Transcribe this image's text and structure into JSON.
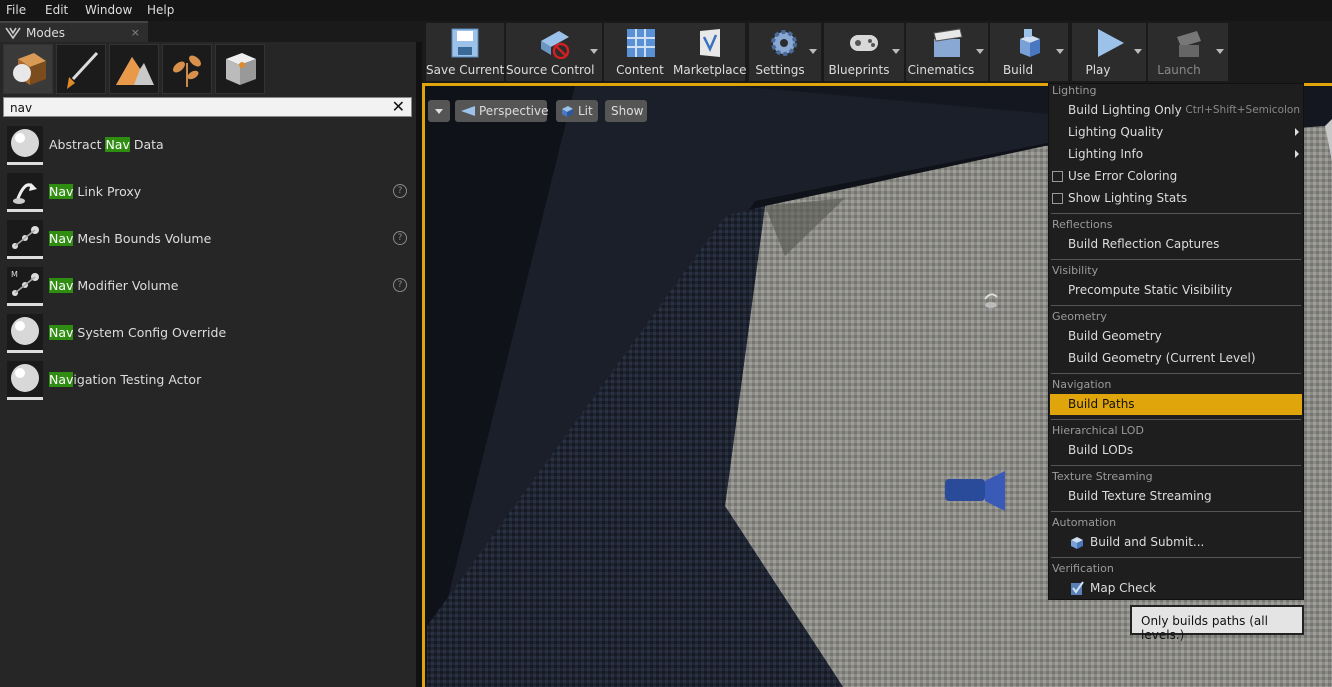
{
  "menubar": {
    "items": [
      "File",
      "Edit",
      "Window",
      "Help"
    ]
  },
  "modes": {
    "tab_title": "Modes",
    "close_glyph": "×",
    "search": {
      "value": "nav",
      "clear_glyph": "✕"
    },
    "results": [
      {
        "pre": "Abstract ",
        "hl": "Nav",
        "post": " Data",
        "help": false
      },
      {
        "pre": "",
        "hl": "Nav",
        "post": " Link Proxy",
        "help": true
      },
      {
        "pre": "",
        "hl": "Nav",
        "post": " Mesh Bounds Volume",
        "help": true
      },
      {
        "pre": "",
        "hl": "Nav",
        "post": " Modifier Volume",
        "help": true
      },
      {
        "pre": "",
        "hl": "Nav",
        "post": " System Config Override",
        "help": false
      },
      {
        "pre": "",
        "hl": "Nav",
        "post": "igation Testing Actor",
        "help": false
      }
    ],
    "help_glyph": "?"
  },
  "toolbar": {
    "save_current": "Save Current",
    "source_control": "Source Control",
    "content": "Content",
    "marketplace": "Marketplace",
    "settings": "Settings",
    "blueprints": "Blueprints",
    "cinematics": "Cinematics",
    "build": "Build",
    "play": "Play",
    "launch": "Launch"
  },
  "viewport": {
    "perspective": "Perspective",
    "lit": "Lit",
    "show": "Show"
  },
  "build_menu": {
    "sections": {
      "lighting": "Lighting",
      "reflections": "Reflections",
      "visibility": "Visibility",
      "geometry": "Geometry",
      "navigation": "Navigation",
      "hlod": "Hierarchical LOD",
      "texture_streaming": "Texture Streaming",
      "automation": "Automation",
      "verification": "Verification"
    },
    "items": {
      "build_lighting_only": "Build Lighting Only",
      "build_lighting_only_shortcut": "Ctrl+Shift+Semicolon",
      "lighting_quality": "Lighting Quality",
      "lighting_info": "Lighting Info",
      "use_error_coloring": "Use Error Coloring",
      "show_lighting_stats": "Show Lighting Stats",
      "build_reflection_captures": "Build Reflection Captures",
      "precompute_static_visibility": "Precompute Static Visibility",
      "build_geometry": "Build Geometry",
      "build_geometry_current": "Build Geometry (Current Level)",
      "build_paths": "Build Paths",
      "build_lods": "Build LODs",
      "build_texture_streaming": "Build Texture Streaming",
      "build_and_submit": "Build and Submit...",
      "map_check": "Map Check"
    }
  },
  "tooltip": "Only builds paths (all levels.)",
  "colors": {
    "accent": "#e0a50b",
    "highlight": "#2f8d12"
  }
}
